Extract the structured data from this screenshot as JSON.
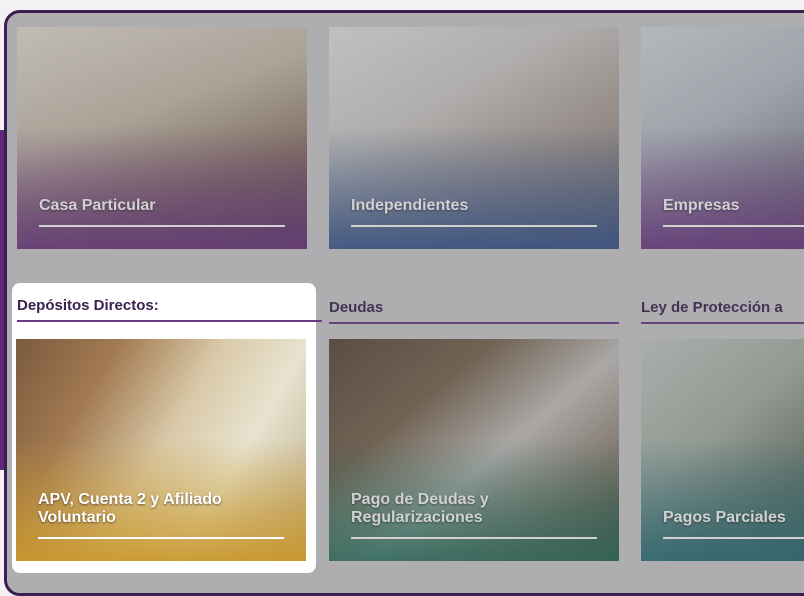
{
  "row1": [
    {
      "label": "Casa Particular"
    },
    {
      "label": "Independientes"
    },
    {
      "label": "Empresas"
    }
  ],
  "sections": [
    {
      "heading": "Depósitos Directos:",
      "tile": "APV, Cuenta 2 y Afiliado Voluntario"
    },
    {
      "heading": "Deudas",
      "tile": "Pago de Deudas y Regularizaciones"
    },
    {
      "heading": "Ley de Protección a",
      "tile": "Pagos Parciales"
    }
  ],
  "colors": {
    "brand_purple": "#5e2a7e",
    "scrim_purple": "#6a2f86",
    "scrim_blue": "#2a4f8f",
    "scrim_teal": "#1f6e7a"
  }
}
